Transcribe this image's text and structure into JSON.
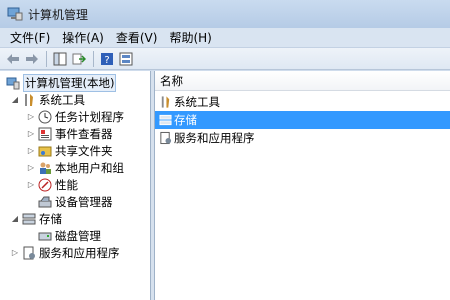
{
  "window": {
    "title": "计算机管理"
  },
  "menu": [
    {
      "label": "文件(F)"
    },
    {
      "label": "操作(A)"
    },
    {
      "label": "查看(V)"
    },
    {
      "label": "帮助(H)"
    }
  ],
  "toolbar": {
    "buttons": [
      "back-icon",
      "forward-icon",
      "show-hide-tree-icon",
      "export-list-icon",
      "help-icon",
      "properties-icon"
    ]
  },
  "tree": {
    "root": {
      "label": "计算机管理(本地)"
    },
    "items": [
      {
        "label": "系统工具",
        "expander": "◢",
        "icon": "tools-icon"
      },
      {
        "label": "任务计划程序",
        "expander": "▷",
        "icon": "clock-icon"
      },
      {
        "label": "事件查看器",
        "expander": "▷",
        "icon": "event-viewer-icon"
      },
      {
        "label": "共享文件夹",
        "expander": "▷",
        "icon": "shared-folder-icon"
      },
      {
        "label": "本地用户和组",
        "expander": "▷",
        "icon": "users-icon"
      },
      {
        "label": "性能",
        "expander": "▷",
        "icon": "performance-icon"
      },
      {
        "label": "设备管理器",
        "expander": "",
        "icon": "device-manager-icon"
      },
      {
        "label": "存储",
        "expander": "◢",
        "icon": "storage-icon"
      },
      {
        "label": "磁盘管理",
        "expander": "",
        "icon": "disk-icon"
      },
      {
        "label": "服务和应用程序",
        "expander": "▷",
        "icon": "services-icon"
      }
    ]
  },
  "list": {
    "column_header": "名称",
    "rows": [
      {
        "label": "系统工具",
        "icon": "tools-icon"
      },
      {
        "label": "存储",
        "icon": "storage-icon",
        "selected": true
      },
      {
        "label": "服务和应用程序",
        "icon": "services-icon"
      }
    ]
  },
  "colors": {
    "selection": "#3399ff",
    "titlebar": "#b5cbe6"
  }
}
